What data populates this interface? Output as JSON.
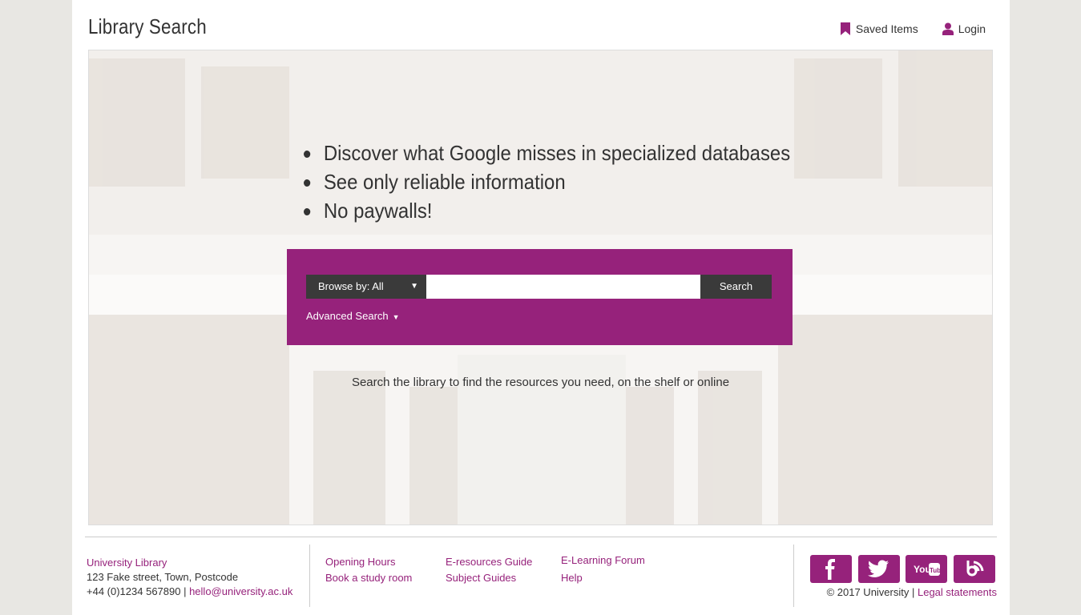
{
  "header": {
    "title": "Library Search",
    "saved_items": "Saved Items",
    "login": "Login"
  },
  "hero": {
    "bullets": [
      "Discover what Google misses in specialized databases",
      "See only reliable information",
      "No paywalls!"
    ],
    "tagline": "Search the library to find the resources you need, on the shelf or online"
  },
  "search": {
    "browse_label": "Browse by: All",
    "input_value": "",
    "placeholder": "",
    "button_label": "Search",
    "advanced_label": "Advanced Search"
  },
  "footer": {
    "library_name": "University Library",
    "address": "123 Fake street, Town, Postcode",
    "phone": "+44 (0)1234 567890 |",
    "email": "hello@university.ac.uk",
    "links": {
      "opening_hours": "Opening Hours",
      "book_room": "Book a study room",
      "eresources": "E-resources Guide",
      "subject_guides": "Subject Guides",
      "elearning": "E-Learning Forum",
      "help": "Help"
    },
    "social": [
      "facebook-icon",
      "twitter-icon",
      "youtube-icon",
      "blog-icon"
    ],
    "copyright": "© 2017 University |",
    "legal": "Legal statements"
  },
  "colors": {
    "brand": "#96227b",
    "dark_control": "#3a3a3a",
    "page_bg": "#e8e7e3"
  }
}
